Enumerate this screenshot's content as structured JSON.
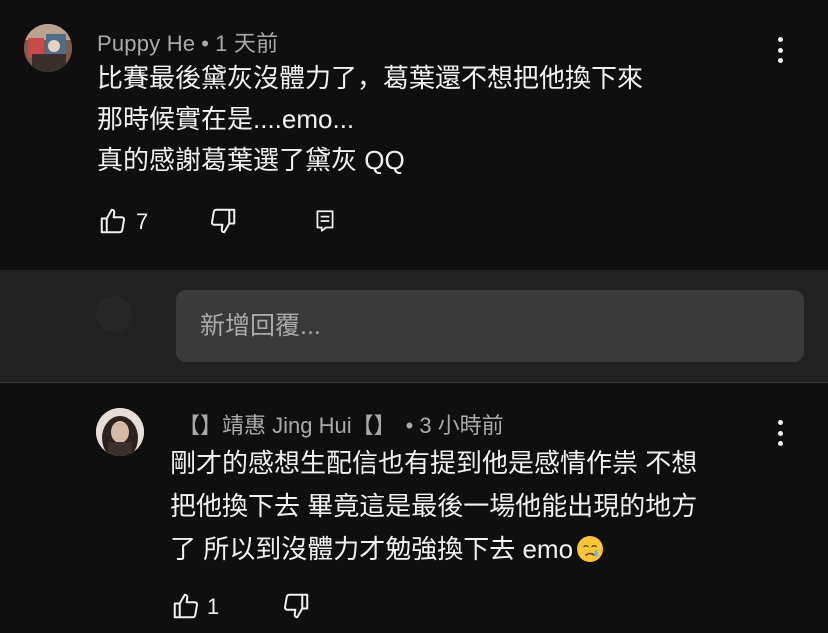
{
  "top_comment": {
    "author": "Puppy He",
    "separator": "•",
    "time": "1 天前",
    "lines": [
      "比賽最後黛灰沒體力了，葛葉還不想把他換下來",
      "那時候實在是....emo...",
      "真的感謝葛葉選了黛灰 QQ"
    ],
    "like_count": "7",
    "icons": {
      "like": "thumbs-up-icon",
      "dislike": "thumbs-down-icon",
      "reply": "reply-comment-icon",
      "more": "more-vertical-icon"
    }
  },
  "reply_box": {
    "placeholder": "新增回覆..."
  },
  "reply_comment": {
    "author": "【】靖惠 Jing Hui【】",
    "separator": "•",
    "time": "3 小時前",
    "lines": [
      "剛才的感想生配信也有提到他是感情作祟 不想",
      "把他換下去 畢竟這是最後一場他能出現的地方",
      "了 所以到沒體力才勉強換下去 emo"
    ],
    "emoji": "crying-face-emoji",
    "like_count": "1",
    "icons": {
      "like": "thumbs-up-icon",
      "dislike": "thumbs-down-icon",
      "more": "more-vertical-icon"
    }
  },
  "colors": {
    "background": "#0f0f0f",
    "reply_band": "#212121",
    "input_bg": "#3a3a3a",
    "primary_text": "#f1f1f1",
    "secondary_text": "#aaaaaa"
  }
}
